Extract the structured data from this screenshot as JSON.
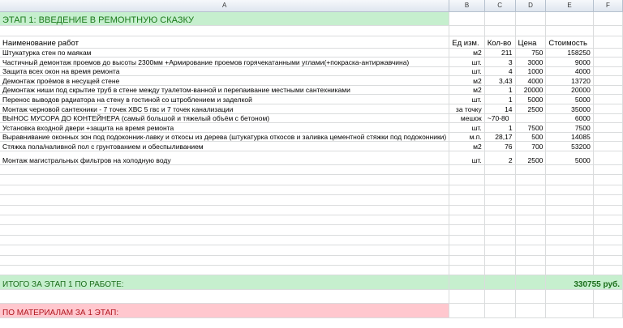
{
  "columns": [
    "A",
    "B",
    "C",
    "D",
    "E",
    "F"
  ],
  "title": "ЭТАП 1: ВВЕДЕНИЕ В РЕМОНТНУЮ СКАЗКУ",
  "headers": {
    "name": "Наименование работ",
    "unit": "Ед изм.",
    "qty": "Кол-во",
    "price": "Цена",
    "cost": "Стоимость"
  },
  "rows": [
    {
      "name": "Штукатурка стен по маякам",
      "unit": "м2",
      "qty": "211",
      "price": "750",
      "cost": "158250"
    },
    {
      "name": "Частичный демонтаж  проемов до высоты 2300мм +Армирование проемов горячекатанными углами(+покраска-антиржавчина)",
      "unit": "шт.",
      "qty": "3",
      "price": "3000",
      "cost": "9000"
    },
    {
      "name": "Защита всех окон на время ремонта",
      "unit": "шт.",
      "qty": "4",
      "price": "1000",
      "cost": "4000"
    },
    {
      "name": "Демонтаж проёмов в несущей стене",
      "unit": "м2",
      "qty": "3,43",
      "price": "4000",
      "cost": "13720"
    },
    {
      "name": "Демонтаж ниши под скрытие труб в стене между туалетом-ванной и перепаивание местными сантехниками",
      "unit": "м2",
      "qty": "1",
      "price": "20000",
      "cost": "20000"
    },
    {
      "name": "Перенос выводов радиатора на стену в гостиной со штроблением и заделкой",
      "unit": "шт.",
      "qty": "1",
      "price": "5000",
      "cost": "5000"
    },
    {
      "name": "Монтаж черновой сантехники - 7 точек ХВС 5 гвс и 7 точек канализации",
      "unit": "за точку",
      "qty": "14",
      "price": "2500",
      "cost": "35000"
    },
    {
      "name": "ВЫНОС МУСОРА ДО КОНТЕЙНЕРА (самый большой и тяжелый объём с бетоном)",
      "unit": "мешок",
      "qty": "~70-80",
      "price": "",
      "cost": "6000"
    },
    {
      "name": "Установка входной двери +защита на время ремонта",
      "unit": "шт.",
      "qty": "1",
      "price": "7500",
      "cost": "7500"
    },
    {
      "name": "Выравнивание оконных зон под подоконник-лавку и откосы из дерева (штукатурка откосов и заливка цементной стяжки под подоконники)",
      "unit": "м.п.",
      "qty": "28,17",
      "price": "500",
      "cost": "14085"
    },
    {
      "name": "Стяжка пола/наливной пол с грунтованием и обеспыливанием",
      "unit": "м2",
      "qty": "76",
      "price": "700",
      "cost": "53200"
    },
    {
      "name": "Монтаж магистральных фильтров на холодную воду",
      "unit": "шт.",
      "qty": "2",
      "price": "2500",
      "cost": "5000"
    }
  ],
  "total": {
    "label": "ИТОГО ЗА ЭТАП 1 ПО РАБОТЕ:",
    "value": "330755 руб."
  },
  "materials": {
    "label": "ПО МАТЕРИАЛАМ ЗА 1 ЭТАП:"
  },
  "colors": {
    "green_fill": "#c6efce",
    "pink_fill": "#ffc7ce",
    "green_text": "#1b7a1b",
    "red_text": "#b0151e"
  }
}
